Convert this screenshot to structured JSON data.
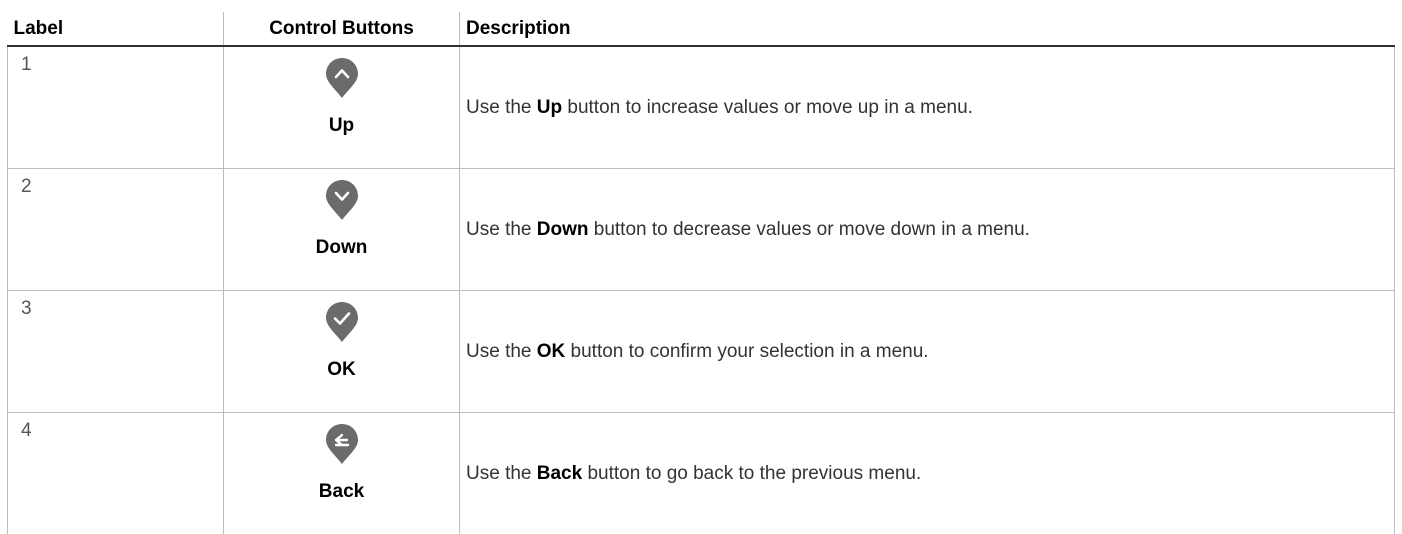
{
  "headers": {
    "label": "Label",
    "controls": "Control Buttons",
    "description": "Description"
  },
  "rows": [
    {
      "label": "1",
      "icon": "up-icon",
      "name": "Up",
      "desc_prefix": "Use the ",
      "desc_bold": "Up",
      "desc_suffix": " button to increase values or move up in a menu."
    },
    {
      "label": "2",
      "icon": "down-icon",
      "name": "Down",
      "desc_prefix": "Use the ",
      "desc_bold": "Down",
      "desc_suffix": " button to decrease values or move down in a menu."
    },
    {
      "label": "3",
      "icon": "check-icon",
      "name": "OK",
      "desc_prefix": "Use the ",
      "desc_bold": "OK",
      "desc_suffix": " button to confirm your selection in a menu."
    },
    {
      "label": "4",
      "icon": "back-icon",
      "name": "Back",
      "desc_prefix": "Use the ",
      "desc_bold": "Back",
      "desc_suffix": " button to go back to the previous menu."
    }
  ],
  "colors": {
    "pin": "#6b6b6b",
    "glyph": "#ffffff",
    "rule": "#bdbdbd",
    "header_rule": "#333333"
  }
}
